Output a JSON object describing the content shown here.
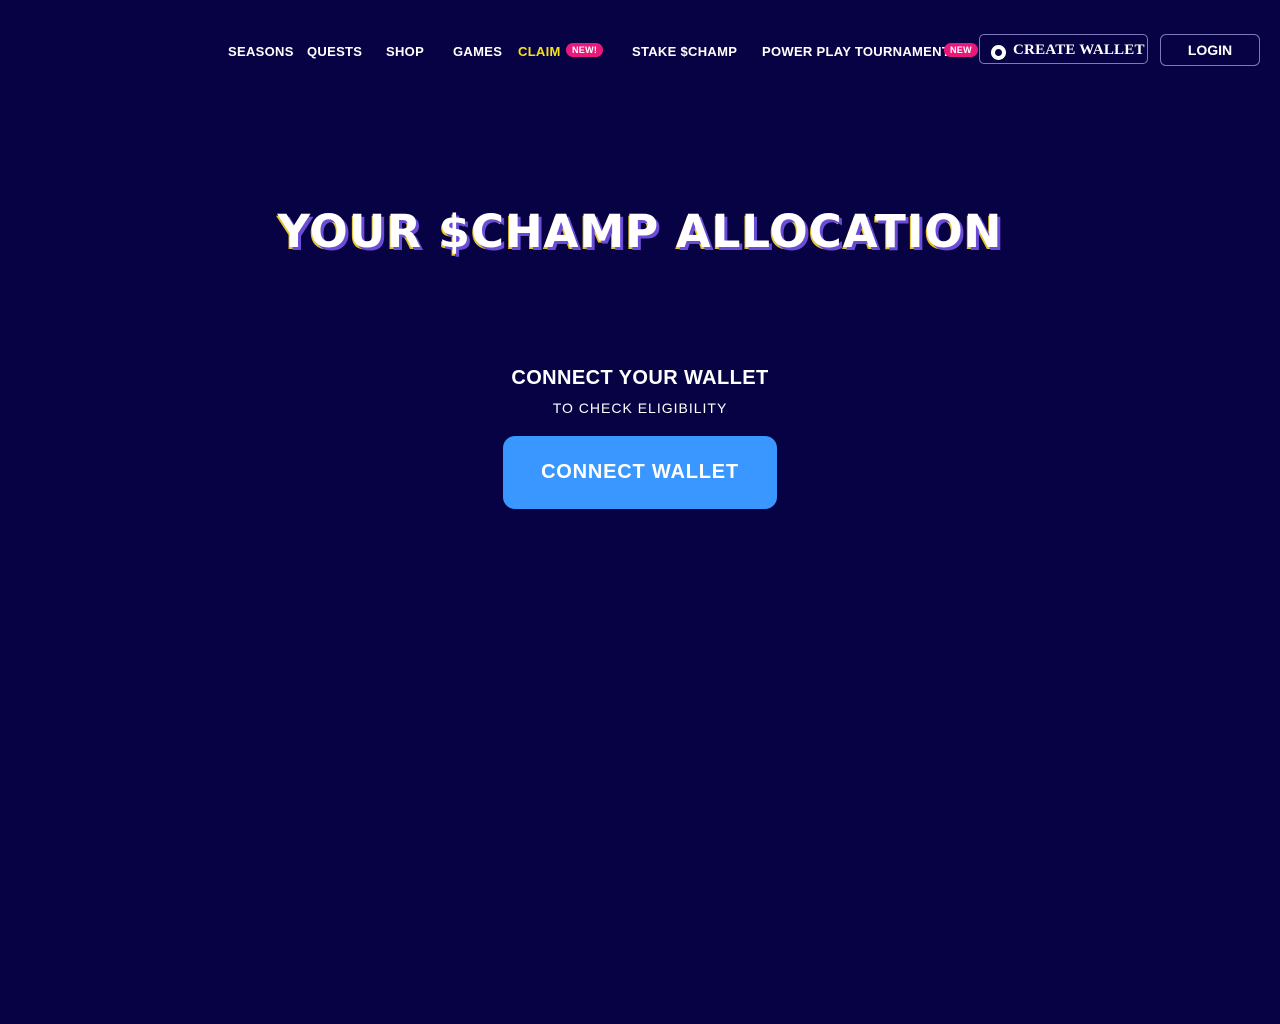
{
  "nav": {
    "seasons": "SEASONS",
    "quests": "QUESTS",
    "shop": "SHOP",
    "games": "GAMES",
    "claim": "CLAIM",
    "claim_badge": "NEW!",
    "stake": "STAKE $CHAMP",
    "tournament": "POWER PLAY TOURNAMENT",
    "tournament_badge": "NEW",
    "create_wallet": "CREATE WALLET",
    "login": "LOGIN"
  },
  "main": {
    "title": "YOUR $CHAMP ALLOCATION",
    "connect_heading": "CONNECT YOUR WALLET",
    "connect_sub": "TO CHECK ELIGIBILITY",
    "connect_button": "CONNECT WALLET"
  },
  "colors": {
    "background": "#070243",
    "claim_text": "#f6e21b",
    "badge": "#e8197b",
    "connect_button": "#3a97ff"
  }
}
